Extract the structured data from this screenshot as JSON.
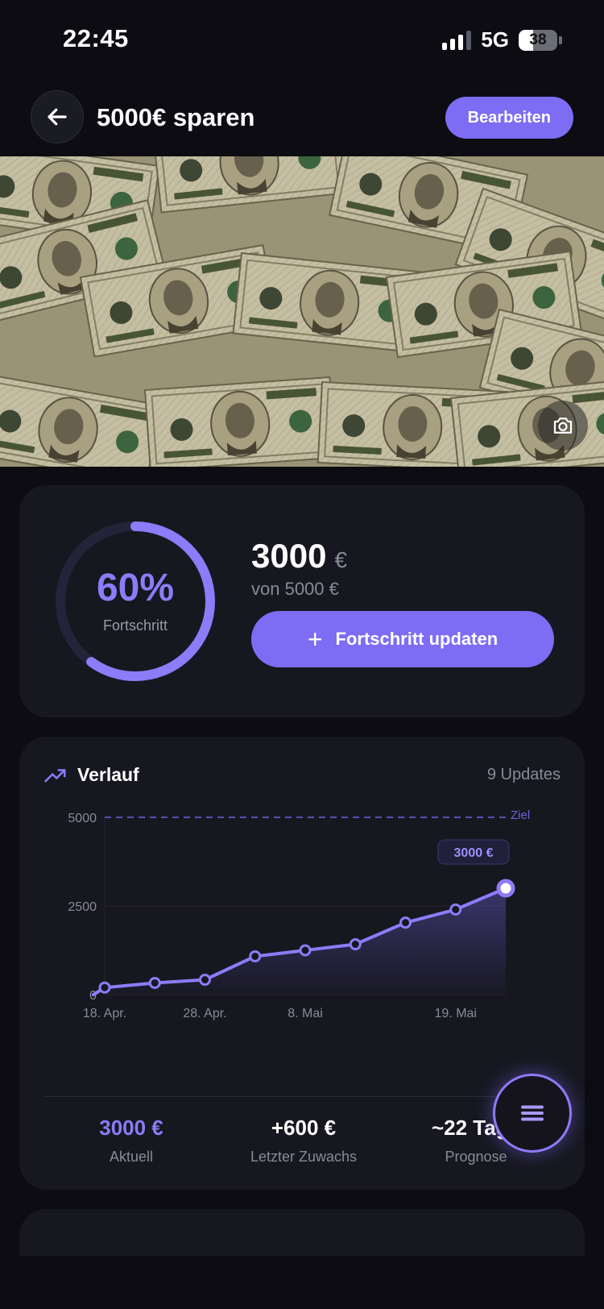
{
  "status_bar": {
    "time": "22:45",
    "network": "5G",
    "battery": "38",
    "battery_level": 0.38
  },
  "header": {
    "title": "5000€ sparen",
    "edit_label": "Bearbeiten"
  },
  "progress": {
    "percent_label": "60%",
    "percent": 60,
    "label": "Fortschritt",
    "current": "3000",
    "currency": "€",
    "goal_text": "von 5000 €",
    "update_label": "Fortschritt updaten"
  },
  "history": {
    "title": "Verlauf",
    "count_label": "9 Updates",
    "stats": [
      {
        "value": "3000 €",
        "label": "Aktuell"
      },
      {
        "value": "+600 €",
        "label": "Letzter Zuwachs"
      },
      {
        "value": "~22 Tage",
        "label": "Prognose"
      }
    ]
  },
  "chart_data": {
    "type": "area",
    "x": [
      "18. Apr.",
      "23. Apr.",
      "28. Apr.",
      "4. Mai",
      "8. Mai",
      "12. Mai",
      "16. Mai",
      "19. Mai",
      "20. Mai"
    ],
    "x_tick_labels": [
      "18. Apr.",
      "28. Apr.",
      "8. Mai",
      "19. Mai"
    ],
    "y_ticks": [
      "5000",
      "2500",
      "0"
    ],
    "values": [
      200,
      330,
      420,
      1080,
      1250,
      1420,
      2030,
      2400,
      3000
    ],
    "ylim": [
      0,
      5000
    ],
    "goal": 5000,
    "goal_label": "Ziel",
    "last_value_label": "3000 €",
    "color": "#8d7bf8"
  },
  "colors": {
    "accent": "#7d6cf4",
    "card": "#171720",
    "background": "#0c0c12"
  },
  "icons": {
    "back": "arrow-left-icon",
    "camera": "camera-icon",
    "trend": "trending-up-icon",
    "menu": "menu-icon",
    "plus": "plus-icon"
  }
}
